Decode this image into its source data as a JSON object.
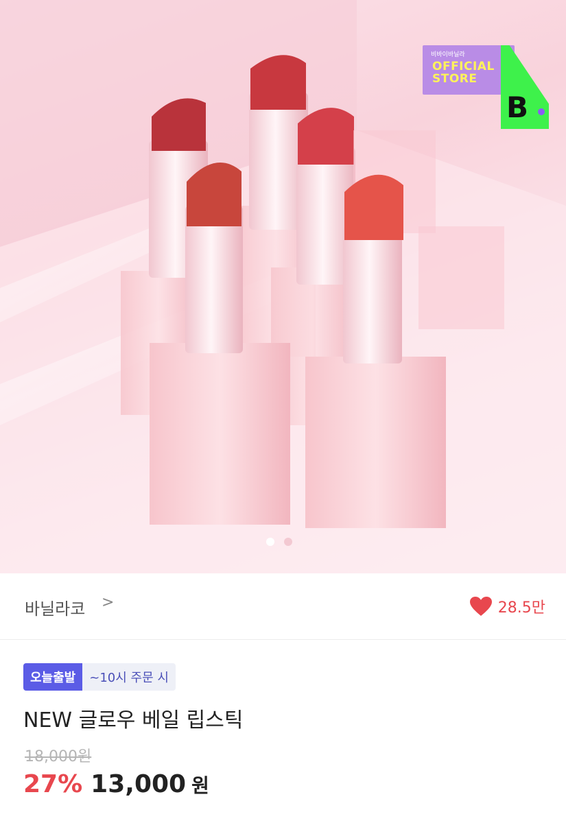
{
  "product_image": {
    "description_icon": "lipstick-product-photo",
    "badge": {
      "kr_label": "비바이바닐라",
      "official_line1": "OFFICIAL",
      "official_line2": "STORE",
      "logo_letter": "B"
    },
    "pager": {
      "current": 1,
      "total": 2
    }
  },
  "brand": {
    "name": "바닐라코",
    "chevron": ">"
  },
  "likes": {
    "icon": "heart-icon",
    "count": "28.5만",
    "color": "#e8474e"
  },
  "tags": {
    "today_shipping": "오늘출발",
    "cutoff": "~10시 주문 시"
  },
  "product": {
    "title": "NEW 글로우 베일 립스틱",
    "original_price": "18,000원",
    "discount": "27%",
    "price": "13,000",
    "currency": "원"
  },
  "colors": {
    "accent_red": "#e8474e",
    "tag_purple": "#5b5ce6",
    "badge_green": "#3ef14b",
    "badge_purple": "#b98ce6"
  }
}
